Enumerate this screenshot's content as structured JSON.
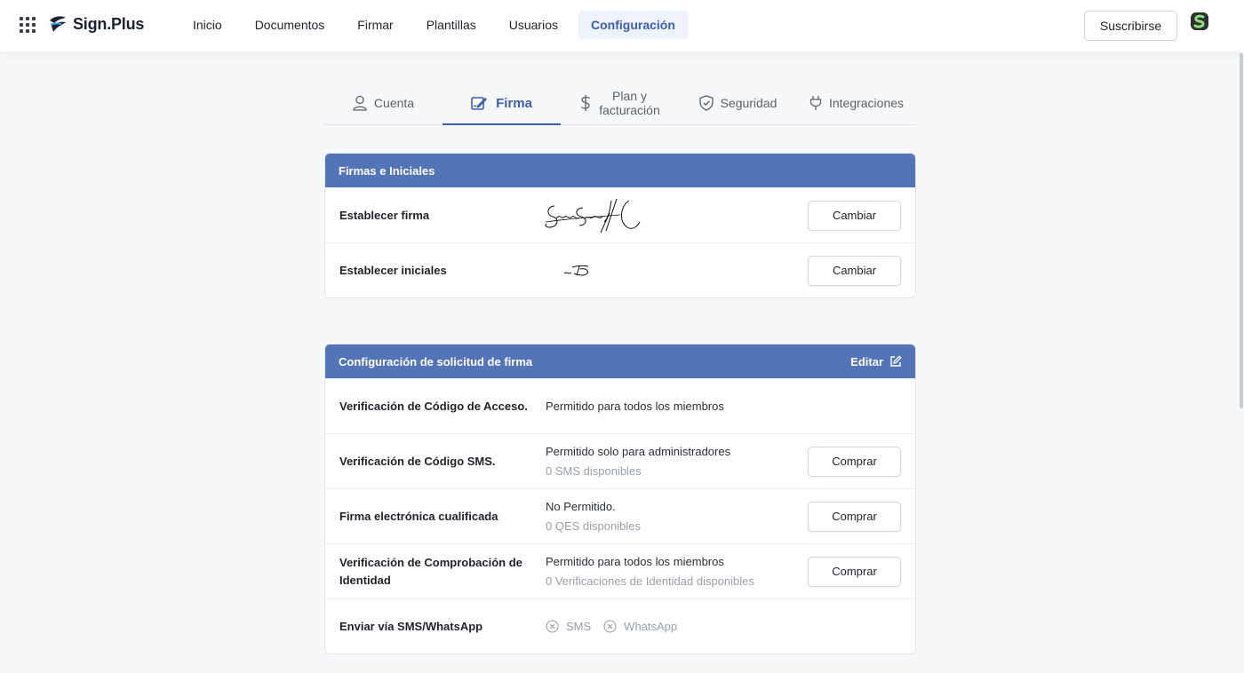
{
  "brand": {
    "name": "Sign.Plus",
    "accent": "#3c5fae",
    "header_blue": "#5474b8"
  },
  "nav": {
    "items": [
      {
        "label": "Inicio"
      },
      {
        "label": "Documentos"
      },
      {
        "label": "Firmar"
      },
      {
        "label": "Plantillas"
      },
      {
        "label": "Usuarios"
      },
      {
        "label": "Configuración",
        "active": true
      }
    ],
    "subscribe_label": "Suscribirse"
  },
  "tabs": [
    {
      "label": "Cuenta",
      "icon": "user-icon"
    },
    {
      "label": "Firma",
      "icon": "signature-icon",
      "active": true
    },
    {
      "label_line1": "Plan y",
      "label_line2": "facturación",
      "icon": "dollar-icon"
    },
    {
      "label": "Seguridad",
      "icon": "shield-icon"
    },
    {
      "label": "Integraciones",
      "icon": "plug-icon"
    }
  ],
  "signatures": {
    "title": "Firmas e Iniciales",
    "rows": [
      {
        "label": "Establecer firma",
        "button": "Cambiar"
      },
      {
        "label": "Establecer iniciales",
        "button": "Cambiar"
      }
    ]
  },
  "request_config": {
    "title": "Configuración de solicitud de firma",
    "edit_label": "Editar",
    "rows": [
      {
        "label": "Verificación de Código de Acceso.",
        "value": "Permitido para todos los miembros"
      },
      {
        "label": "Verificación de Código SMS.",
        "value": "Permitido solo para administradores",
        "sub": "0 SMS disponibles",
        "button": "Comprar"
      },
      {
        "label": "Firma electrónica cualificada",
        "value": "No Permitido.",
        "sub": "0 QES disponibles",
        "button": "Comprar"
      },
      {
        "label": "Verificación de Comprobación de Identidad",
        "value": "Permitido para todos los miembros",
        "sub": "0 Verificaciones de Identidad disponibles",
        "button": "Comprar"
      },
      {
        "label": "Enviar vía SMS/WhatsApp",
        "options": [
          {
            "label": "SMS",
            "icon": "x-circle-icon"
          },
          {
            "label": "WhatsApp",
            "icon": "x-circle-icon"
          }
        ]
      }
    ]
  }
}
